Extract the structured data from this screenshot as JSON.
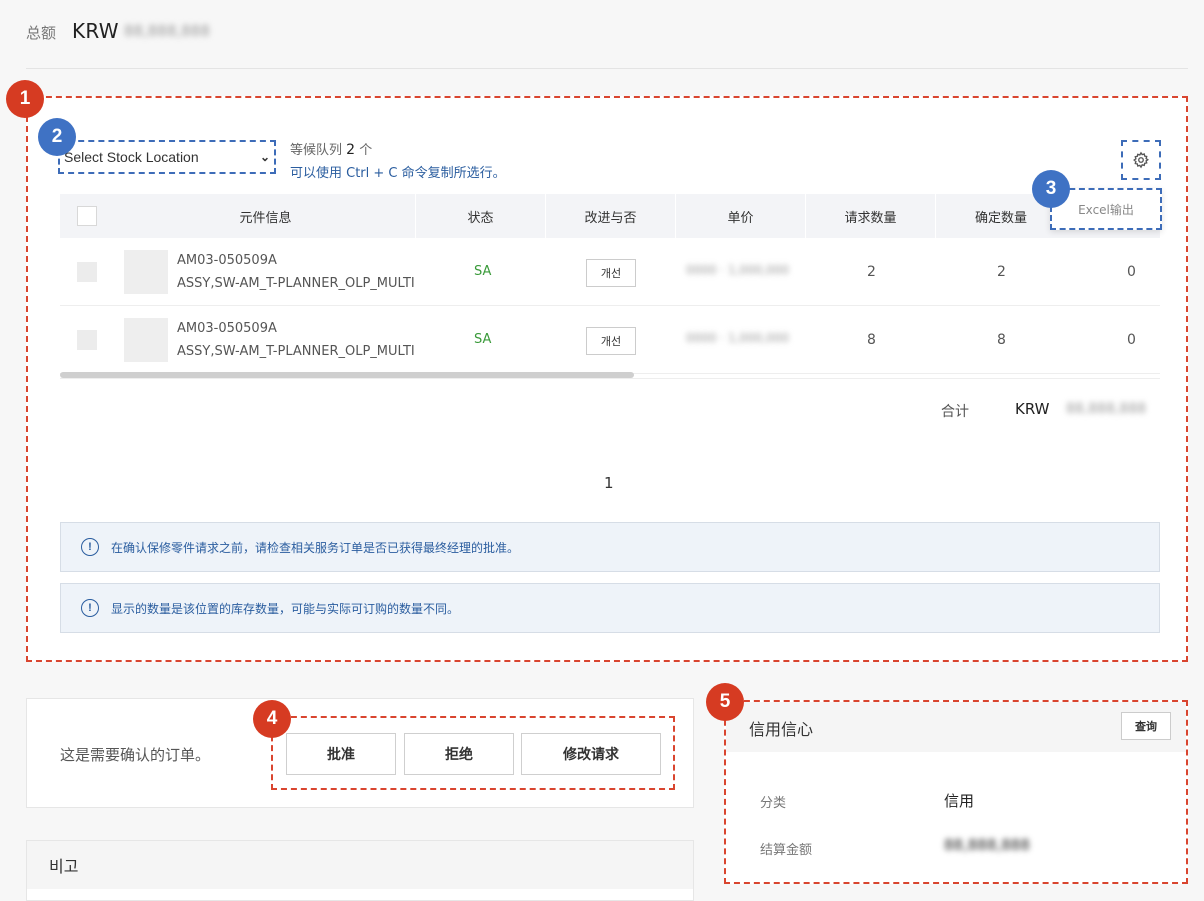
{
  "header": {
    "total_label": "总额",
    "currency": "KRW",
    "total_value": "88,888,888"
  },
  "badges": [
    "1",
    "2",
    "3",
    "4",
    "5"
  ],
  "toolbar": {
    "stock_select_placeholder": "Select Stock Location",
    "queue_prefix": "等候队列",
    "queue_count": "2",
    "queue_suffix": "个",
    "copy_hint": "可以使用 Ctrl + C 命令复制所选行。",
    "excel_export": "Excel输出"
  },
  "table": {
    "headers": [
      "元件信息",
      "状态",
      "改进与否",
      "单价",
      "请求数量",
      "确定数量"
    ],
    "rows": [
      {
        "part_no": "AM03-050509A",
        "part_name": "ASSY,SW-AM_T-PLANNER_OLP_MULTI",
        "status": "SA",
        "improve": "개선",
        "price": "0000 · 1,000,000",
        "requested": "2",
        "confirmed": "2",
        "extra": "0"
      },
      {
        "part_no": "AM03-050509A",
        "part_name": "ASSY,SW-AM_T-PLANNER_OLP_MULTI",
        "status": "SA",
        "improve": "개선",
        "price": "0000 · 1,000,000",
        "requested": "8",
        "confirmed": "8",
        "extra": "0"
      }
    ],
    "sum_label": "合计",
    "sum_currency": "KRW",
    "sum_value": "88,888,888",
    "page": "1"
  },
  "notices": [
    "在确认保修零件请求之前，请检查相关服务订单是否已获得最终经理的批准。",
    "显示的数量是该位置的库存数量，可能与实际可订购的数量不同。"
  ],
  "approval": {
    "message": "这是需要确认的订单。",
    "approve": "批准",
    "reject": "拒绝",
    "modify": "修改请求"
  },
  "remarks": {
    "title": "비고"
  },
  "credit": {
    "title": "信用信心",
    "query": "查询",
    "category_label": "分类",
    "category_value": "信用",
    "amount_label": "结算金额",
    "amount_value": "88,888,888"
  },
  "colors": {
    "annotation_red": "#d63b22",
    "annotation_blue": "#3f72c4",
    "link_blue": "#2a5d9f",
    "status_green": "#3a9a3a"
  }
}
